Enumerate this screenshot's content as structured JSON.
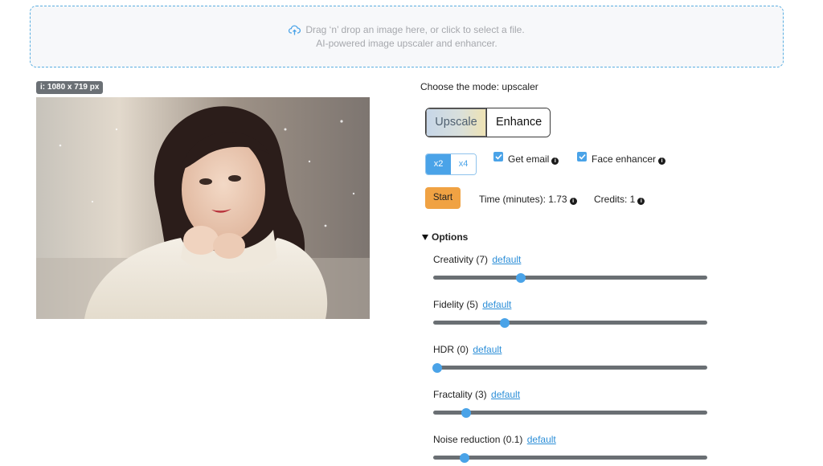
{
  "dropzone": {
    "line1": "Drag ‘n’ drop an image here, or click to select a file.",
    "line2": "AI-powered image upscaler and enhancer.",
    "icon": "cloud-upload-icon"
  },
  "preview": {
    "dimensions": "i: 1080 x 719 px"
  },
  "mode": {
    "title": "Choose the mode: upscaler",
    "options": [
      "Upscale",
      "Enhance"
    ],
    "selected": "Upscale"
  },
  "scale": {
    "options": [
      "x2",
      "x4"
    ],
    "selected": "x2"
  },
  "checkboxes": {
    "email": {
      "label": "Get email",
      "checked": true
    },
    "face": {
      "label": "Face enhancer",
      "checked": true
    }
  },
  "actions": {
    "start": "Start",
    "time": "Time (minutes): 1.73",
    "credits": "Credits: 1"
  },
  "options": {
    "label": "Options",
    "default_link": "default",
    "sliders": [
      {
        "label": "Creativity (7)",
        "fraction": 0.32
      },
      {
        "label": "Fidelity (5)",
        "fraction": 0.26
      },
      {
        "label": "HDR (0)",
        "fraction": 0.015
      },
      {
        "label": "Fractality (3)",
        "fraction": 0.12
      },
      {
        "label": "Noise reduction (0.1)",
        "fraction": 0.115
      }
    ]
  },
  "colors": {
    "accent": "#4aa3e8",
    "start": "#f0a243",
    "track": "#6a6f73",
    "dropzone_border": "#5aaee0"
  }
}
